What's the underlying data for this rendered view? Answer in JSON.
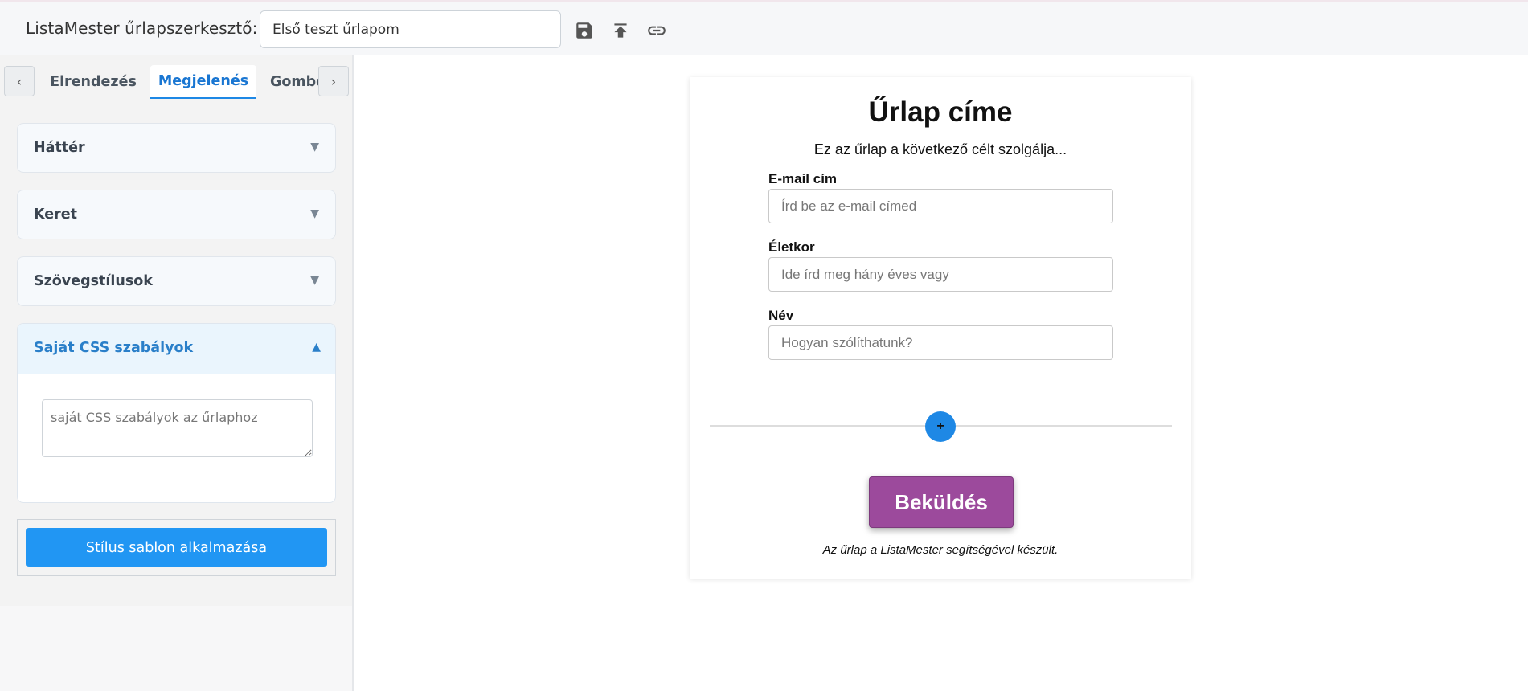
{
  "toolbar": {
    "app_title": "ListaMester űrlapszerkesztő:",
    "form_name": "Első teszt űrlapom",
    "icons": [
      "save-icon",
      "publish-icon",
      "link-icon"
    ]
  },
  "sidebar": {
    "tab_prev": "‹",
    "tab_next": "›",
    "tabs": [
      {
        "label": "Elrendezés",
        "active": false
      },
      {
        "label": "Megjelenés",
        "active": true
      },
      {
        "label": "Gombok",
        "active": false
      }
    ],
    "sections": [
      {
        "label": "Háttér",
        "arrow": "▼"
      },
      {
        "label": "Keret",
        "arrow": "▼"
      },
      {
        "label": "Szövegstílusok",
        "arrow": "▼"
      }
    ],
    "open_section": {
      "label": "Saját CSS szabályok",
      "arrow": "▲",
      "textarea_placeholder": "saját CSS szabályok az űrlaphoz"
    },
    "apply_button": "Stílus sablon alkalmazása"
  },
  "form": {
    "title": "Űrlap címe",
    "description": "Ez az űrlap a következő célt szolgálja...",
    "fields": [
      {
        "label": "E-mail cím",
        "placeholder": "Írd be az e-mail címed"
      },
      {
        "label": "Életkor",
        "placeholder": "Ide írd meg hány éves vagy"
      },
      {
        "label": "Név",
        "placeholder": "Hogyan szólíthatunk?"
      }
    ],
    "add_button": "+",
    "submit": "Beküldés",
    "footer": "Az űrlap a ListaMester segítségével készült."
  },
  "colors": {
    "accent": "#2196f3",
    "active_tab": "#1976d2",
    "submit_bg": "#9c4a9c",
    "open_section_bg": "#eaf5fd"
  }
}
